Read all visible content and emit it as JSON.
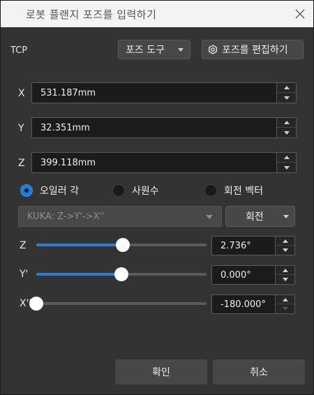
{
  "window": {
    "title": "로봇 플랜지 포즈를 입력하기"
  },
  "tcp": {
    "label": "TCP",
    "pose_tool_label": "포즈 도구",
    "edit_pose_label": "포즈를 편집하기"
  },
  "position": [
    {
      "axis": "X",
      "value": "531.187mm"
    },
    {
      "axis": "Y",
      "value": "32.351mm"
    },
    {
      "axis": "Z",
      "value": "399.118mm"
    }
  ],
  "orientation": {
    "options": [
      {
        "label": "오일러 각",
        "selected": true
      },
      {
        "label": "사원수",
        "selected": false
      },
      {
        "label": "회전 벡터",
        "selected": false
      }
    ],
    "convention": "KUKA: Z->Y'->X''",
    "rotate_label": "회전",
    "angles": [
      {
        "axis": "Z",
        "value": "2.736°",
        "slider_fraction": 0.508
      },
      {
        "axis": "Y'",
        "value": "0.000°",
        "slider_fraction": 0.5
      },
      {
        "axis": "X''",
        "value": "-180.000°",
        "slider_fraction": 0.0
      }
    ]
  },
  "footer": {
    "ok_label": "확인",
    "cancel_label": "취소"
  },
  "colors": {
    "accent": "#2e7dd6",
    "background": "#333333"
  }
}
